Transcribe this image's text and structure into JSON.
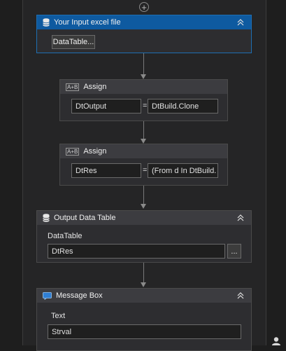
{
  "designer": {
    "add_symbol": "+"
  },
  "activities": [
    {
      "title": "Your Input excel file",
      "icon": "database-icon",
      "chip_label": "DataTable..."
    },
    {
      "title": "Assign",
      "icon": "assign-icon",
      "icon_text": "A+B",
      "to": "DtOutput",
      "equals": "=",
      "value": "DtBuild.Clone"
    },
    {
      "title": "Assign",
      "icon": "assign-icon",
      "icon_text": "A+B",
      "to": "DtRes",
      "equals": "=",
      "value": "(From d In DtBuild."
    },
    {
      "title": "Output Data Table",
      "icon": "database-icon",
      "field_label": "DataTable",
      "field_value": "DtRes",
      "browse_label": "..."
    },
    {
      "title": "Message Box",
      "icon": "message-box-icon",
      "field_label": "Text",
      "field_value": "Strval"
    }
  ],
  "colors": {
    "selected_header": "#0e5aa0",
    "header": "#3c3c40",
    "canvas": "#252526"
  }
}
